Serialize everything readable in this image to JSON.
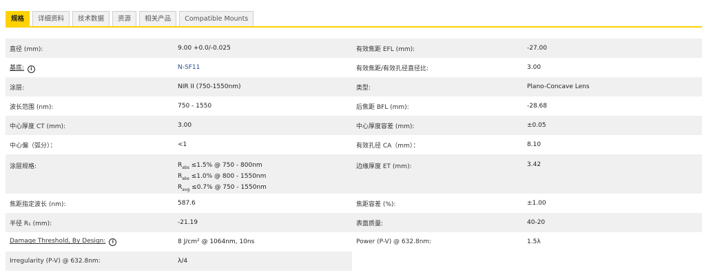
{
  "tabs": [
    {
      "label": "规格",
      "active": true
    },
    {
      "label": "详细资料"
    },
    {
      "label": "技术数据"
    },
    {
      "label": "资源"
    },
    {
      "label": "相关产品"
    },
    {
      "label": "Compatible Mounts"
    }
  ],
  "accent_color": "#ffd200",
  "rows": [
    {
      "l1": "直径 (mm):",
      "v1": "9.00 +0.0/-0.025",
      "l2": "有效焦距 EFL (mm):",
      "v2": "-27.00"
    },
    {
      "l1": "基底:",
      "v1": "N-SF11",
      "l2": "有效焦距/有效孔径直径比:",
      "v2": "3.00"
    },
    {
      "l1": "涂层:",
      "v1": "NIR II (750-1550nm)",
      "l2": "类型:",
      "v2": "Plano-Concave Lens"
    },
    {
      "l1": "波长范围 (nm):",
      "v1": "750 - 1550",
      "l2": "后焦距 BFL (mm):",
      "v2": "-28.68"
    },
    {
      "l1": "中心厚度 CT (mm):",
      "v1": "3.00",
      "l2": "中心厚度容差 (mm):",
      "v2": "±0.05"
    },
    {
      "l1": "中心偏（弧分）：",
      "v1": "<1",
      "l2": "有效孔径 CA（mm）：",
      "v2": "8.10"
    },
    {
      "l1": "涂层规格:",
      "v1_lines": [
        {
          "r": "R",
          "sub": "abs",
          "rest": " ≤1.5% @ 750 - 800nm"
        },
        {
          "r": "R",
          "sub": "abs",
          "rest": " ≤1.0% @ 800 - 1550nm"
        },
        {
          "r": "R",
          "sub": "avg",
          "rest": " ≤0.7% @ 750 - 1550nm"
        }
      ],
      "l2": "边缘厚度 ET (mm):",
      "v2": "3.42"
    },
    {
      "l1": "焦距指定波长 (nm):",
      "v1": "587.6",
      "l2": "焦距容差 (%):",
      "v2": "±1.00"
    },
    {
      "l1": "半径 R₁ (mm):",
      "v1": "-21.19",
      "l2": "表面质量:",
      "v2": "40-20"
    },
    {
      "l1": "Damage Threshold, By Design:",
      "v1": "8 J/cm² @ 1064nm, 10ns",
      "l2": "Power (P-V) @ 632.8nm:",
      "v2": "1.5λ"
    },
    {
      "l1": "Irregularity (P-V) @ 632.8nm:",
      "v1": "λ/4"
    }
  ],
  "info_glyph": "i"
}
